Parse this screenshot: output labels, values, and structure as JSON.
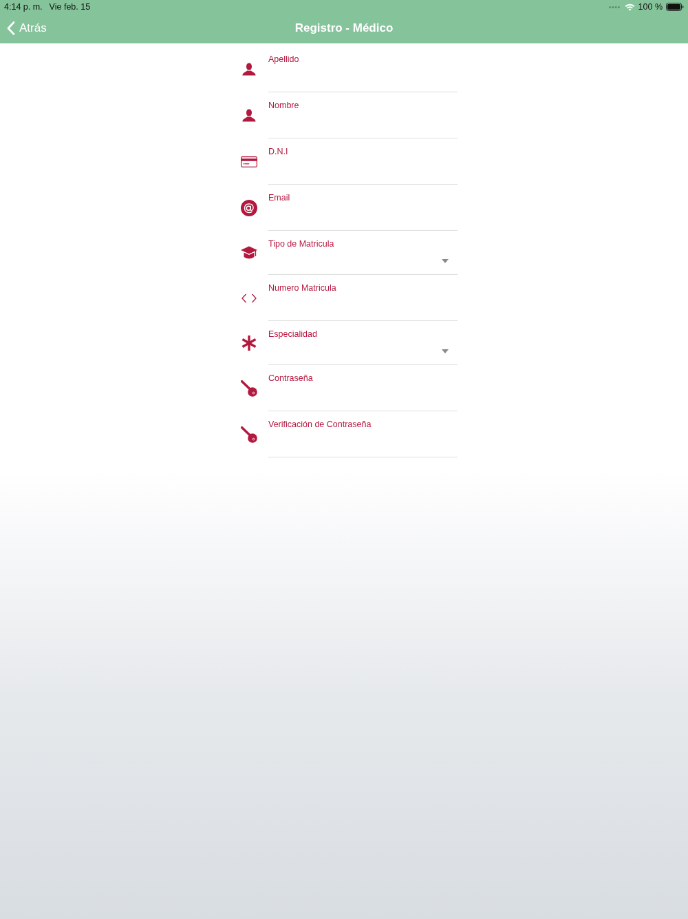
{
  "status_bar": {
    "time": "4:14 p. m.",
    "date": "Vie feb. 15",
    "battery": "100 %"
  },
  "nav_bar": {
    "back": "Atrás",
    "title": "Registro - Médico"
  },
  "form": {
    "fields": [
      {
        "label": "Apellido",
        "kind": "text"
      },
      {
        "label": "Nombre",
        "kind": "text"
      },
      {
        "label": "D.N.I",
        "kind": "text"
      },
      {
        "label": "Email",
        "kind": "text"
      },
      {
        "label": "Tipo de Matricula",
        "kind": "select"
      },
      {
        "label": "Numero Matricula",
        "kind": "text"
      },
      {
        "label": "Especialidad",
        "kind": "select"
      },
      {
        "label": "Contraseña",
        "kind": "text"
      },
      {
        "label": "Verificación de Contraseña",
        "kind": "text"
      }
    ]
  }
}
